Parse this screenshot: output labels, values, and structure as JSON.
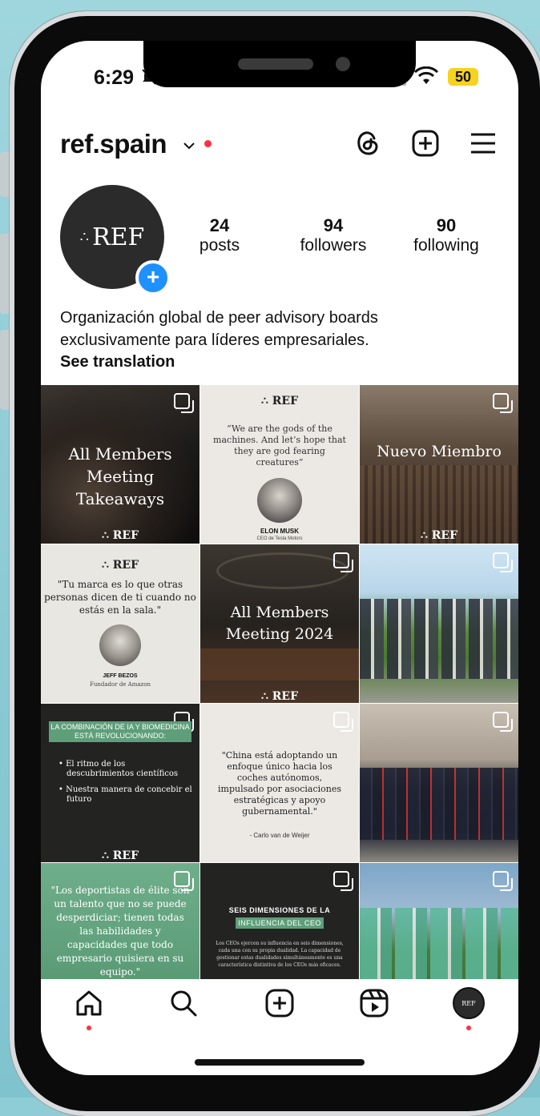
{
  "status_bar": {
    "time": "6:29",
    "battery": "50"
  },
  "header": {
    "username": "ref.spain"
  },
  "profile": {
    "avatar_text": "REF",
    "stats": [
      {
        "value": "24",
        "label": "posts"
      },
      {
        "value": "94",
        "label": "followers"
      },
      {
        "value": "90",
        "label": "following"
      }
    ],
    "bio_line1": "Organización global de peer advisory boards",
    "bio_line2": "exclusivamente para líderes empresariales.",
    "see_translation": "See translation"
  },
  "posts": {
    "p1": {
      "title_line1": "All Members",
      "title_line2": "Meeting Takeaways",
      "logo": "REF"
    },
    "p2": {
      "logo": "REF",
      "quote_line1": "“We are the gods of the",
      "quote_line2": "machines. And let’s hope that",
      "quote_line3": "they are god fearing",
      "quote_line4": "creatures”",
      "name": "ELON MUSK",
      "role": "CEO de Tesla Motors"
    },
    "p3": {
      "title": "Nuevo Miembro",
      "logo": "REF"
    },
    "p4": {
      "logo": "REF",
      "quote_line1": "\"Tu marca es lo que otras",
      "quote_line2": "personas dicen de ti cuando no",
      "quote_line3": "estás en la sala.\"",
      "name": "JEFF BEZOS",
      "role": "Fundador de Amazon"
    },
    "p5": {
      "title_line1": "All Members",
      "title_line2": "Meeting 2024",
      "logo": "REF"
    },
    "p7": {
      "banner_line1": "LA COMBINACIÓN DE IA Y BIOMEDICINA",
      "banner_line2": "ESTÁ REVOLUCIONANDO:",
      "bullet1_line1": "El ritmo de los",
      "bullet1_line2": "descubrimientos científicos",
      "bullet2_line1": "Nuestra manera de concebir el",
      "bullet2_line2": "futuro",
      "logo": "REF"
    },
    "p8": {
      "quote_line1": "\"China está adoptando un",
      "quote_line2": "enfoque único hacia los",
      "quote_line3": "coches autónomos,",
      "quote_line4": "impulsado por asociaciones",
      "quote_line5": "estratégicas y apoyo",
      "quote_line6": "gubernamental.\"",
      "author": "- Carlo van de Weijer"
    },
    "p10": {
      "quote_line1": "\"Los deportistas de élite son",
      "quote_line2": "un talento que no se puede",
      "quote_line3": "desperdiciar; tienen todas",
      "quote_line4": "las habilidades y",
      "quote_line5": "capacidades que todo",
      "quote_line6": "empresario quisiera en su",
      "quote_line7": "equipo.\""
    },
    "p11": {
      "heading_line1": "SEIS DIMENSIONES DE LA",
      "heading_line2": "INFLUENCIA DEL CEO",
      "body_line1": "Los CEOs ejercen su influencia en seis dimensiones,",
      "body_line2": "cada una con su propia dualidad. La capacidad de",
      "body_line3": "gestionar estas dualidades simultáneamente es una",
      "body_line4": "característica distintiva de los CEOs más eficaces."
    }
  },
  "nav": {
    "profile_text": "REF"
  },
  "colors": {
    "accent_red": "#ff3040",
    "blue": "#1e90ff",
    "green_tile": "#5e9f7a"
  }
}
